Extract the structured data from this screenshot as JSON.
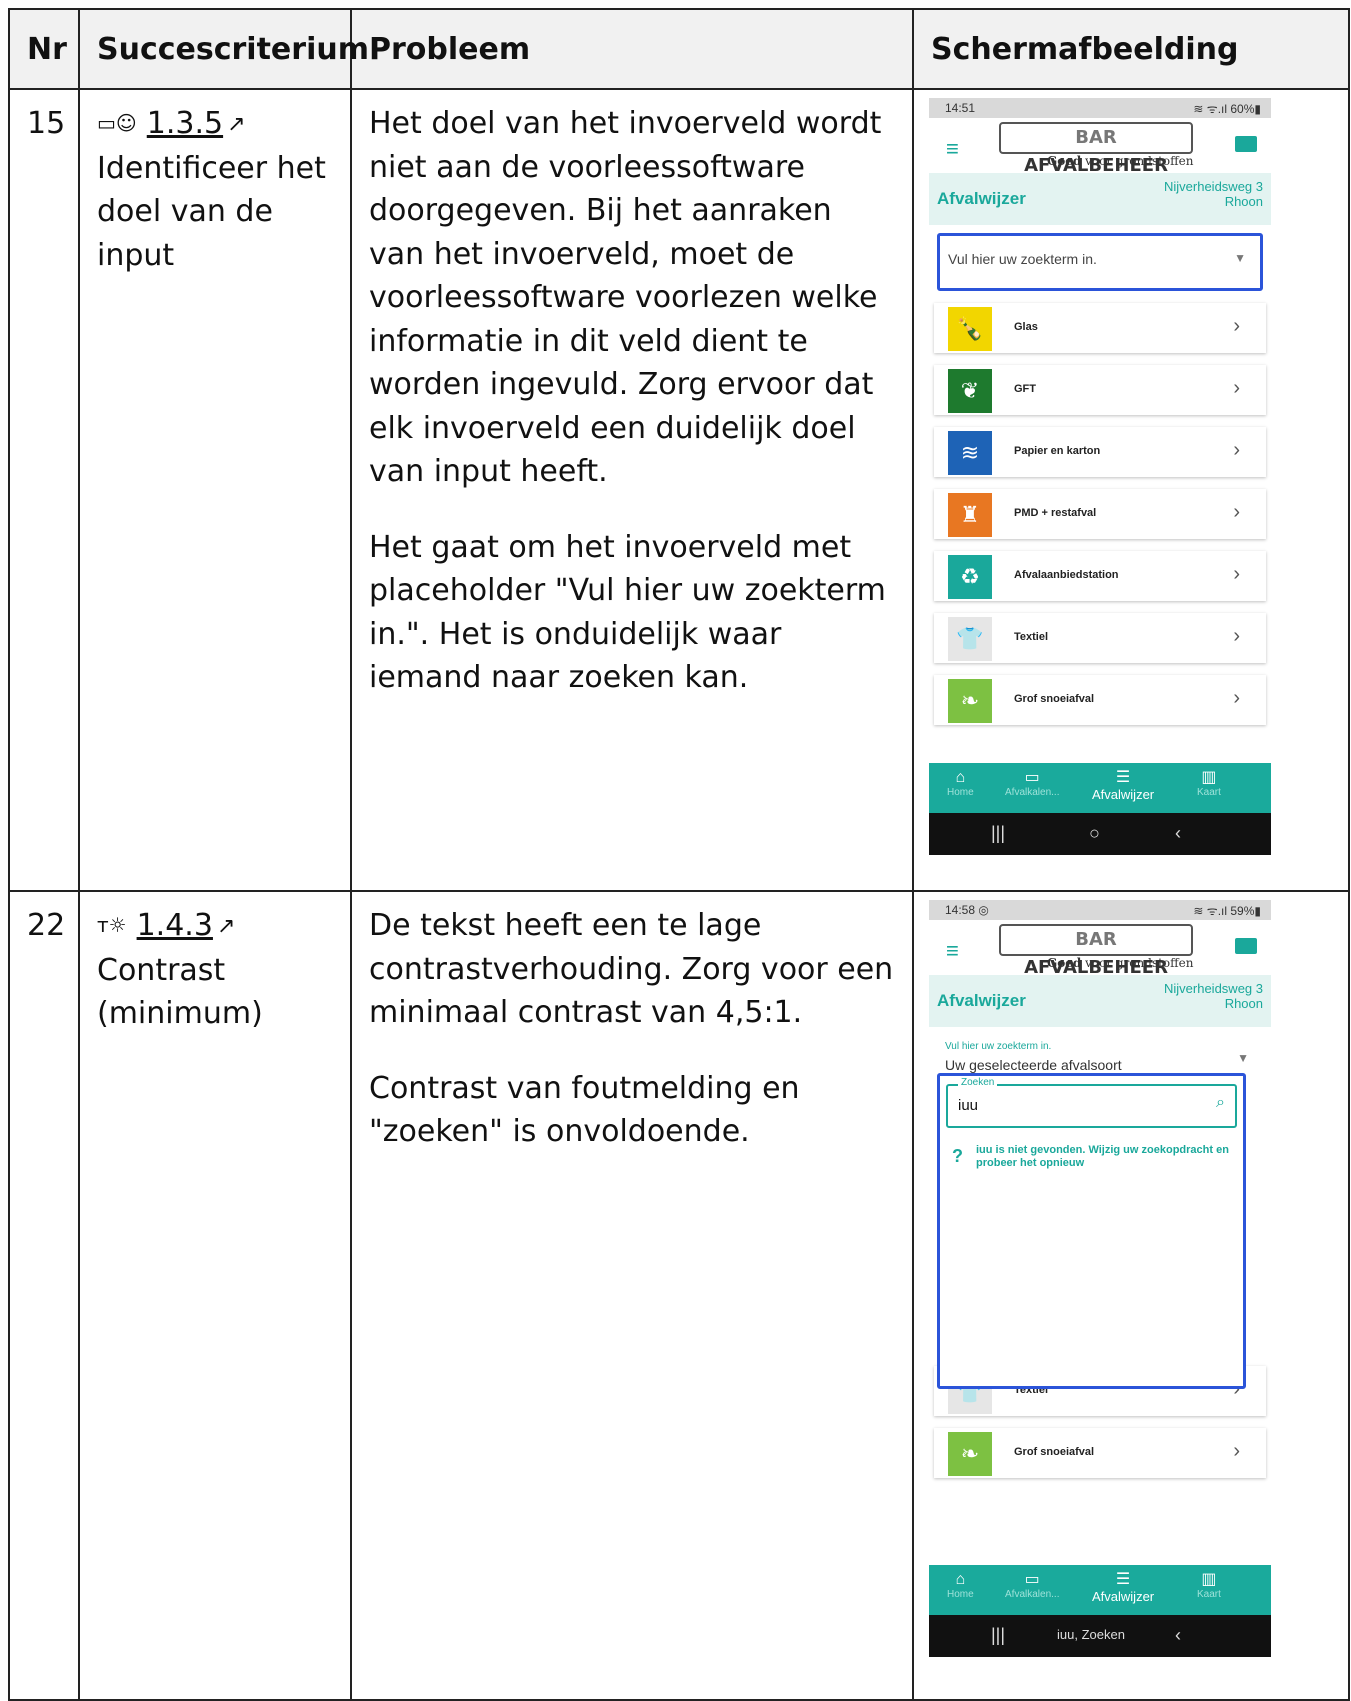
{
  "table": {
    "headers": [
      "Nr",
      "Succescriterium",
      "Probleem",
      "Schermafbeelding"
    ]
  },
  "rows": [
    {
      "nr": "15",
      "criterion_icon": "input-purpose-icon",
      "criterion_code": "1.3.5",
      "criterion_name": "Identificeer het doel van de input",
      "problem_p1": "Het doel van het invoerveld wordt niet aan de voorleessoftware doorgegeven. Bij het aanraken van het invoerveld, moet de voorleessoftware voorlezen welke informatie in dit veld dient te worden ingevuld. Zorg ervoor dat elk invoerveld een duidelijk doel van input heeft.",
      "problem_p2": "Het gaat om het invoerveld met placeholder \"Vul hier uw zoekterm in.\". Het is onduidelijk waar iemand naar zoeken kan."
    },
    {
      "nr": "22",
      "criterion_icon": "contrast-icon",
      "criterion_code": "1.4.3",
      "criterion_name": "Contrast (minimum)",
      "problem_p1": "De tekst heeft een te lage contrastverhouding. Zorg voor een minimaal contrast van 4,5:1.",
      "problem_p2": "Contrast van foutmelding en \"zoeken\" is onvoldoende."
    }
  ],
  "screenshot1": {
    "time": "14:51",
    "status_right": "≋ ᯤ.ıl 60%▮",
    "logo_bar": "BAR",
    "logo_rest": "AFVALBEHEER",
    "tagline_bold": "Goed",
    "tagline_rest": "voor grondstoffen",
    "banner_title": "Afvalwijzer",
    "address_line1": "Nijverheidsweg 3",
    "address_line2": "Rhoon",
    "search_placeholder": "Vul hier uw zoekterm in.",
    "categories": [
      "Glas",
      "GFT",
      "Papier en karton",
      "PMD + restafval",
      "Afvalaanbiedstation",
      "Textiel",
      "Grof snoeiafval"
    ],
    "tabs": [
      "Home",
      "Afvalkalen...",
      "Afvalwijzer",
      "Kaart"
    ]
  },
  "screenshot2": {
    "time": "14:58 ◎",
    "status_right": "≋ ᯤ.ıl 59%▮",
    "select_label": "Vul hier uw zoekterm in.",
    "select_value": "Uw geselecteerde afvalsoort",
    "search_label": "Zoeken",
    "search_value": "iuu",
    "error_message": "iuu is niet gevonden. Wijzig uw zoekopdracht en probeer het opnieuw",
    "visible_categories": [
      "Textiel",
      "Grof snoeiafval"
    ],
    "tabs": [
      "Home",
      "Afvalkalen...",
      "Afvalwijzer",
      "Kaart"
    ],
    "sysnav_text": "iuu, Zoeken"
  },
  "colors": {
    "accent": "#1aa89b",
    "focus_outline": "#2b54d9",
    "glas": "#f2d600",
    "gft": "#1e7a2e",
    "papier": "#1e63b6",
    "pmd": "#e87722",
    "station": "#1aa89b",
    "textiel": "#e6e6e6",
    "snoei": "#7dc142"
  }
}
